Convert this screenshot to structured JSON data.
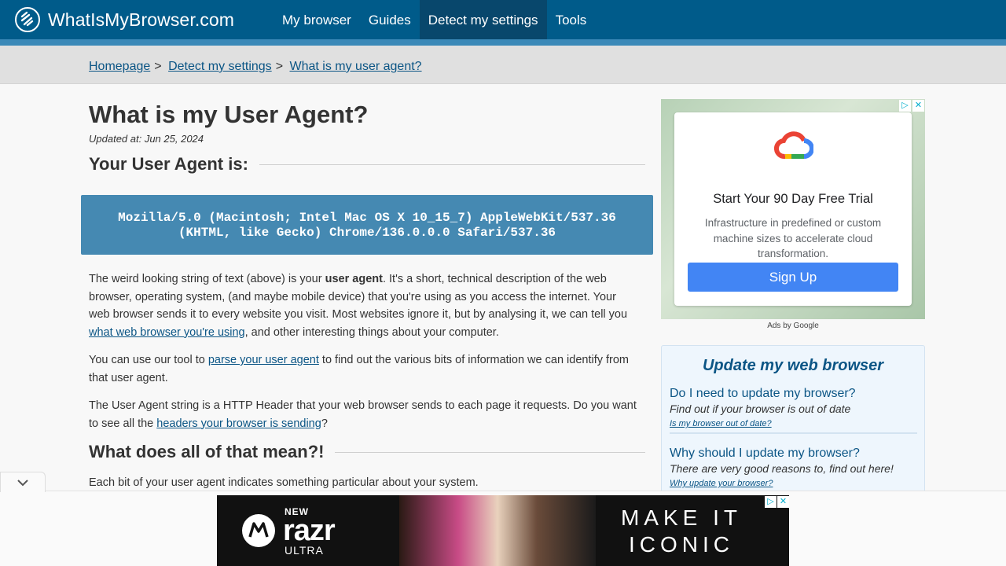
{
  "site": {
    "name": "WhatIsMyBrowser.com"
  },
  "nav": [
    {
      "label": "My browser"
    },
    {
      "label": "Guides"
    },
    {
      "label": "Detect my settings"
    },
    {
      "label": "Tools"
    }
  ],
  "breadcrumb": {
    "items": [
      "Homepage",
      "Detect my settings",
      "What is my user agent?"
    ],
    "separator": ">"
  },
  "main": {
    "title": "What is my User Agent?",
    "updated": "Updated at: Jun 25, 2024",
    "ua_heading": "Your User Agent is:",
    "ua_line1": "Mozilla/5.0 (Macintosh; Intel Mac OS X 10_15_7) AppleWebKit/537.36",
    "ua_line2": "(KHTML, like Gecko) Chrome/136.0.0.0 Safari/537.36",
    "p1_a": "The weird looking string of text (above) is your ",
    "p1_bold": "user agent",
    "p1_b": ". It's a short, technical description of the web browser, operating system, (and maybe mobile device) that you're using as you access the internet. Your web browser sends it to every website you visit. Most websites ignore it, but by analysing it, we can tell you ",
    "p1_link": "what web browser you're using",
    "p1_c": ", and other interesting things about your computer.",
    "p2_a": "You can use our tool to ",
    "p2_link": "parse your user agent",
    "p2_b": " to find out the various bits of information we can identify from that user agent.",
    "p3_a": "The User Agent string is a HTTP Header that your web browser sends to each page it requests. Do you want to see all the ",
    "p3_link": "headers your browser is sending",
    "p3_b": "?",
    "h2_meaning": "What does all of that mean?!",
    "p4": "Each bit of your user agent indicates something particular about your system."
  },
  "sidebar_ad": {
    "title": "Start Your 90 Day Free Trial",
    "description": "Infrastructure in predefined or custom machine sizes to accelerate cloud transformation.",
    "button": "Sign Up",
    "ads_by": "Ads by Google",
    "icon": "google-cloud-icon"
  },
  "update_box": {
    "title": "Update my web browser",
    "items": [
      {
        "question": "Do I need to update my browser?",
        "answer": "Find out if your browser is out of date",
        "link": "Is my browser out of date?"
      },
      {
        "question": "Why should I update my browser?",
        "answer": "There are very good reasons to, find out here!",
        "link": "Why update your browser?"
      }
    ]
  },
  "bottom_ad": {
    "new": "NEW",
    "product": "razr",
    "ultra": "ULTRA",
    "slogan_line1": "MAKE IT",
    "slogan_line2": "ICONIC"
  },
  "colors": {
    "header": "#005b8a",
    "nav_active": "#08476c",
    "ua_box": "#4589b2",
    "link": "#0b5585",
    "ad_button": "#4285f4"
  }
}
